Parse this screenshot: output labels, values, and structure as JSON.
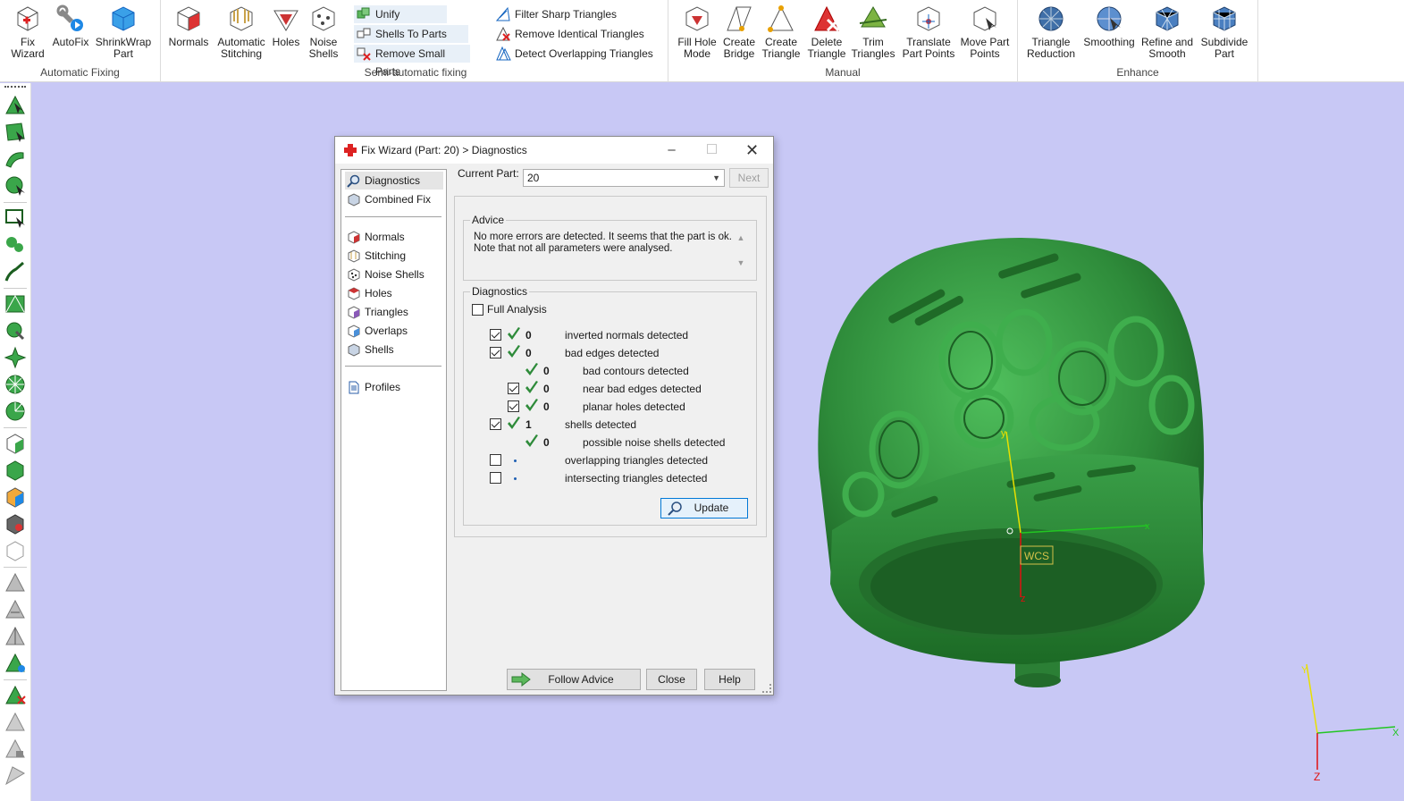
{
  "ribbon": {
    "groups": [
      {
        "label": "Automatic Fixing",
        "buttons": [
          "Fix\nWizard",
          "AutoFix",
          "ShrinkWrap\nPart"
        ]
      },
      {
        "label": "Semi-automatic fixing",
        "buttons": [
          "Normals",
          "Automatic\nStitching",
          "Holes",
          "Noise\nShells"
        ],
        "small_buttons": [
          "Unify",
          "Shells To Parts",
          "Remove Small Parts",
          "Filter Sharp Triangles",
          "Remove Identical Triangles",
          "Detect Overlapping Triangles"
        ]
      },
      {
        "label": "Manual",
        "buttons": [
          "Fill Hole\nMode",
          "Create\nBridge",
          "Create\nTriangle",
          "Delete\nTriangle",
          "Trim\nTriangles",
          "Translate\nPart Points",
          "Move Part\nPoints"
        ]
      },
      {
        "label": "Enhance",
        "buttons": [
          "Triangle\nReduction",
          "Smoothing",
          "Refine and\nSmooth",
          "Subdivide\nPart"
        ]
      }
    ]
  },
  "dialog": {
    "title": "Fix Wizard (Part: 20) > Diagnostics",
    "nav": {
      "top": [
        "Diagnostics",
        "Combined Fix"
      ],
      "middle": [
        "Normals",
        "Stitching",
        "Noise Shells",
        "Holes",
        "Triangles",
        "Overlaps",
        "Shells"
      ],
      "bottom": [
        "Profiles"
      ]
    },
    "current_part_label": "Current Part:",
    "current_part_value": "20",
    "next_label": "Next",
    "advice_title": "Advice",
    "advice_text_1": "No more errors are detected. It seems that the part is ok.",
    "advice_text_2": "Note that not all parameters were analysed.",
    "diagnostics_title": "Diagnostics",
    "full_analysis_label": "Full Analysis",
    "rows": [
      {
        "checkbox": true,
        "checked": true,
        "status": "ok",
        "count": "0",
        "label": "inverted normals detected",
        "indent": 0
      },
      {
        "checkbox": true,
        "checked": true,
        "status": "ok",
        "count": "0",
        "label": "bad edges detected",
        "indent": 0
      },
      {
        "checkbox": false,
        "checked": false,
        "status": "ok",
        "count": "0",
        "label": "bad contours detected",
        "indent": 1
      },
      {
        "checkbox": true,
        "checked": true,
        "status": "ok",
        "count": "0",
        "label": "near bad edges detected",
        "indent": 1
      },
      {
        "checkbox": true,
        "checked": true,
        "status": "ok",
        "count": "0",
        "label": "planar holes detected",
        "indent": 1
      },
      {
        "checkbox": true,
        "checked": true,
        "status": "ok",
        "count": "1",
        "label": "shells detected",
        "indent": 0
      },
      {
        "checkbox": false,
        "checked": false,
        "status": "ok",
        "count": "0",
        "label": "possible noise shells detected",
        "indent": 1
      },
      {
        "checkbox": true,
        "checked": false,
        "status": "none",
        "count": "",
        "label": "overlapping triangles detected",
        "indent": 0
      },
      {
        "checkbox": true,
        "checked": false,
        "status": "none",
        "count": "",
        "label": "intersecting triangles detected",
        "indent": 0
      }
    ],
    "update_label": "Update",
    "follow_advice_label": "Follow Advice",
    "close_label": "Close",
    "help_label": "Help"
  },
  "viewport": {
    "wcs_label": "WCS",
    "axis_x": "x",
    "axis_y": "y",
    "axis_z": "z",
    "corner_x": "X",
    "corner_y": "Y",
    "corner_z": "Z",
    "model_color": "#2e8b3a",
    "background": "#c8c8f5"
  }
}
